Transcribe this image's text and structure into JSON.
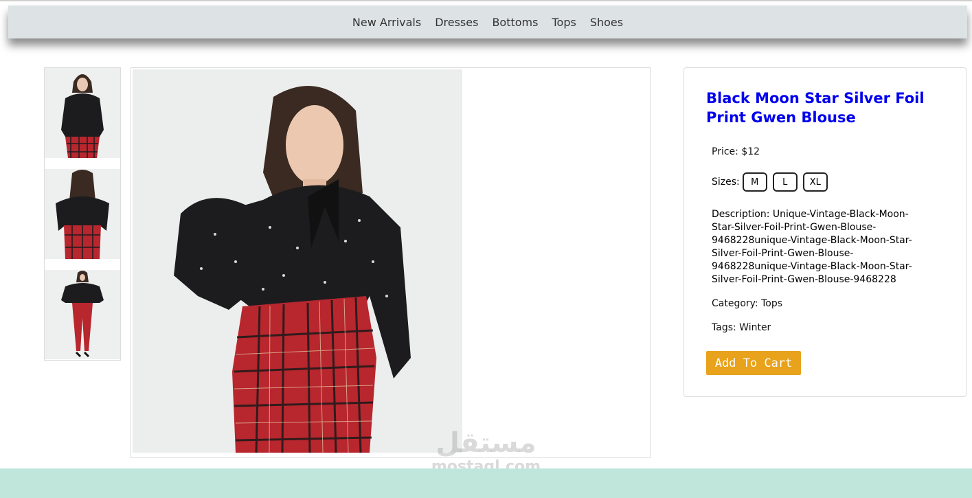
{
  "nav": {
    "items": [
      "New Arrivals",
      "Dresses",
      "Bottoms",
      "Tops",
      "Shoes"
    ]
  },
  "product": {
    "title": "Black Moon Star Silver Foil Print Gwen Blouse",
    "price": "Price: $12",
    "sizes_label": "Sizes:",
    "sizes": [
      "M",
      "L",
      "XL"
    ],
    "description": "Description: Unique-Vintage-Black-Moon-Star-Silver-Foil-Print-Gwen-Blouse-9468228unique-Vintage-Black-Moon-Star-Silver-Foil-Print-Gwen-Blouse-9468228unique-Vintage-Black-Moon-Star-Silver-Foil-Print-Gwen-Blouse-9468228",
    "category": "Category: Tops",
    "tags": "Tags: Winter",
    "add_to_cart": "Add To Cart"
  },
  "watermark": {
    "arabic": "مستقل",
    "latin": "mostaql.com"
  },
  "colors": {
    "title": "#0000ee",
    "cart_button": "#e8a21b",
    "footer": "#c0e6dc",
    "navbar": "#dde3e5",
    "blouse": "#1c1c1e",
    "pants": "#b8262e"
  }
}
